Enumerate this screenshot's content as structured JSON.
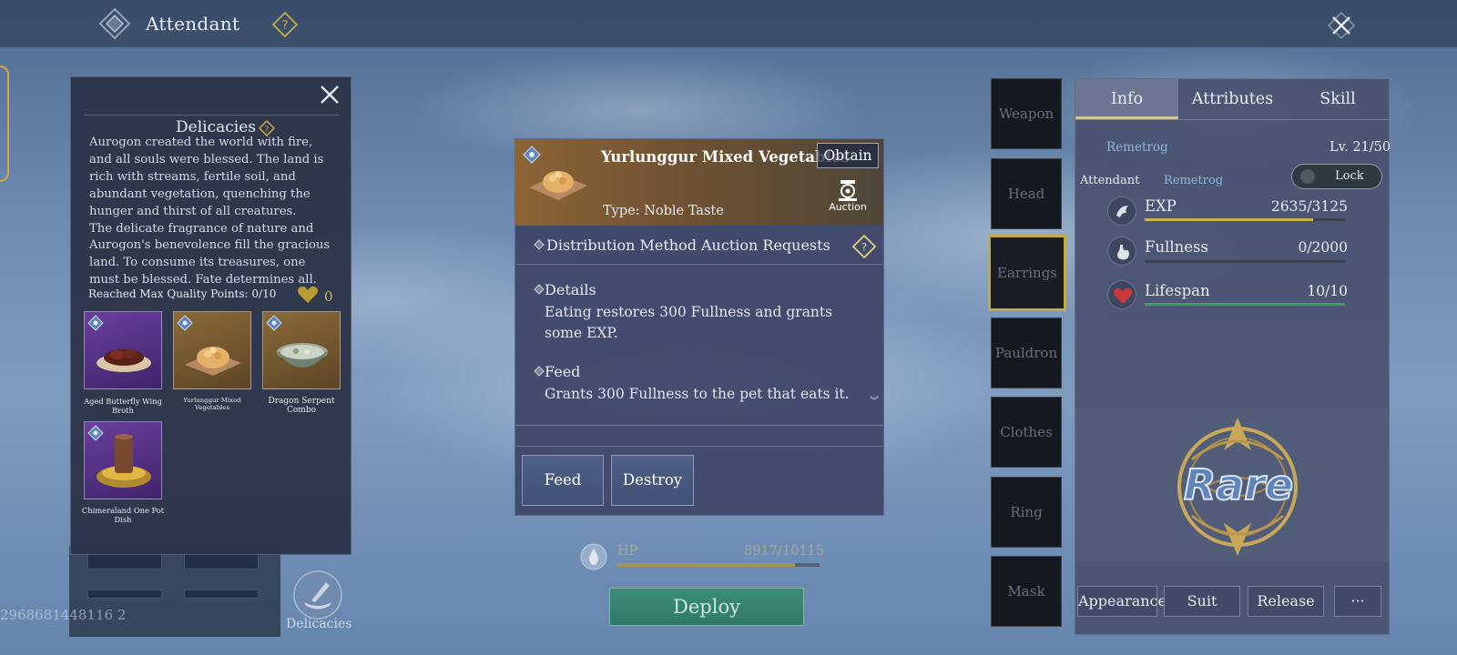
{
  "header": {
    "title": "Attendant"
  },
  "background": {
    "id_text": "2968681448116 2",
    "delicacies_button_label": "Delicacies"
  },
  "delicacies_popup": {
    "title": "Delicacies",
    "description_paragraphs": [
      "Aurogon created the world with fire, and all souls were blessed. The land is rich with streams, fertile soil, and abundant vegetation, quenching the hunger and thirst of all creatures.",
      "The delicate fragrance of nature and Aurogon's benevolence fill the gracious land. To consume its treasures, one must be blessed. Fate determines all."
    ],
    "quality_label": "Reached Max Quality Points: 0/10",
    "quality_count": "0",
    "foods": [
      {
        "name": "Aged Butterfly Wing Broth",
        "rarity": "epic"
      },
      {
        "name": "Yurlunggur Mixed Vegetables",
        "rarity": "rare"
      },
      {
        "name": "Dragon Serpent Combo",
        "rarity": "rare"
      },
      {
        "name": "Chimeraland One Pot Dish",
        "rarity": "epic"
      }
    ]
  },
  "item_card": {
    "title": "Yurlunggur Mixed Vegetables",
    "obtain_label": "Obtain",
    "auction_label": "Auction",
    "type_label": "Type: Noble Taste",
    "distribution_label": "Distribution Method",
    "distribution_value": "Auction Requests",
    "details_label": "Details",
    "details_text": "Eating restores 300 Fullness and grants some EXP.",
    "feed_label": "Feed",
    "feed_text": "Grants 300 Fullness to the pet that eats it.",
    "scroll_glyph": "︾",
    "buttons": {
      "feed": "Feed",
      "destroy": "Destroy"
    }
  },
  "hp": {
    "label": "HP",
    "value": "8917/10115",
    "fraction": 0.88
  },
  "deploy_label": "Deploy",
  "equipment_slots": [
    "Weapon",
    "Head",
    "Earrings",
    "Pauldron",
    "Clothes",
    "Ring",
    "Mask"
  ],
  "selected_slot": "Earrings",
  "info_panel": {
    "tabs": [
      "Info",
      "Attributes",
      "Skill"
    ],
    "active_tab": "Info",
    "pet_name": "Remetrog",
    "level": "Lv. 21/50",
    "attendant_label": "Attendant",
    "attendant_name": "Remetrog",
    "lock_label": "Lock",
    "stats": [
      {
        "label": "EXP",
        "value": "2635/3125",
        "fraction": 0.84,
        "color": "#c9b64a",
        "icon": "exp-icon"
      },
      {
        "label": "Fullness",
        "value": "0/2000",
        "fraction": 0.0,
        "color": "#c9b64a",
        "icon": "stomach-icon"
      },
      {
        "label": "Lifespan",
        "value": "10/10",
        "fraction": 1.0,
        "color": "#3aa05a",
        "icon": "heart-icon"
      }
    ],
    "rarity_label": "Rare",
    "buttons": {
      "appearance": "Appearance",
      "suit": "Suit",
      "release": "Release",
      "more": "···"
    }
  },
  "colors": {
    "accent_gold": "#c3a941",
    "card_header": "#8c6436",
    "deploy_green": "#3b8e78",
    "name_blue": "#8fb3e0"
  }
}
